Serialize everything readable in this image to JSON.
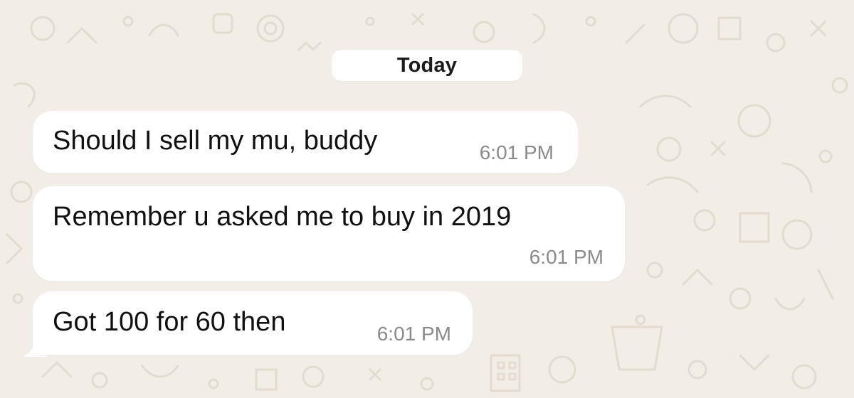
{
  "chat": {
    "date_separator": "Today",
    "messages": [
      {
        "text": "Should I sell my mu, buddy",
        "time": "6:01 PM"
      },
      {
        "text": "Remember u asked me to buy in 2019",
        "time": "6:01 PM"
      },
      {
        "text": "Got 100 for 60 then",
        "time": "6:01 PM"
      }
    ]
  },
  "colors": {
    "background": "#f2eee7",
    "bubble": "#ffffff",
    "time_text": "#8a8a8a",
    "doodle": "#e2dbcf"
  }
}
